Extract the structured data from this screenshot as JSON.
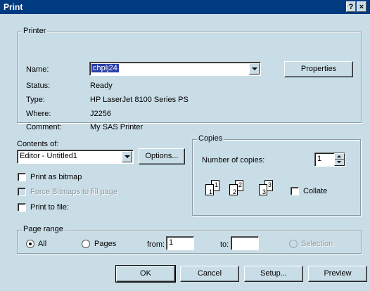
{
  "window": {
    "title": "Print",
    "help": "?",
    "close": "×"
  },
  "printer": {
    "legend": "Printer",
    "name_label": "Name:",
    "name_value": "chplj24",
    "properties": "Properties",
    "status_label": "Status:",
    "status_value": "Ready",
    "type_label": "Type:",
    "type_value": "HP LaserJet 8100 Series PS",
    "where_label": "Where:",
    "where_value": "J2256",
    "comment_label": "Comment:",
    "comment_value": "My SAS Printer"
  },
  "contents": {
    "label": "Contents of:",
    "value": "Editor - Untitled1",
    "options": "Options...",
    "print_as_bitmap": "Print as bitmap",
    "force_bitmaps": "Force Bitmaps to fill page",
    "print_to_file": "Print to file:"
  },
  "copies": {
    "legend": "Copies",
    "number_label": "Number of copies:",
    "number_value": "1",
    "collate": "Collate",
    "pages": [
      "1",
      "1",
      "2",
      "2",
      "3",
      "3"
    ]
  },
  "page_range": {
    "legend": "Page range",
    "all": "All",
    "pages": "Pages",
    "from_label": "from:",
    "from_value": "1",
    "to_label": "to:",
    "to_value": "",
    "selection": "Selection"
  },
  "buttons": {
    "ok": "OK",
    "cancel": "Cancel",
    "setup": "Setup...",
    "preview": "Preview"
  }
}
